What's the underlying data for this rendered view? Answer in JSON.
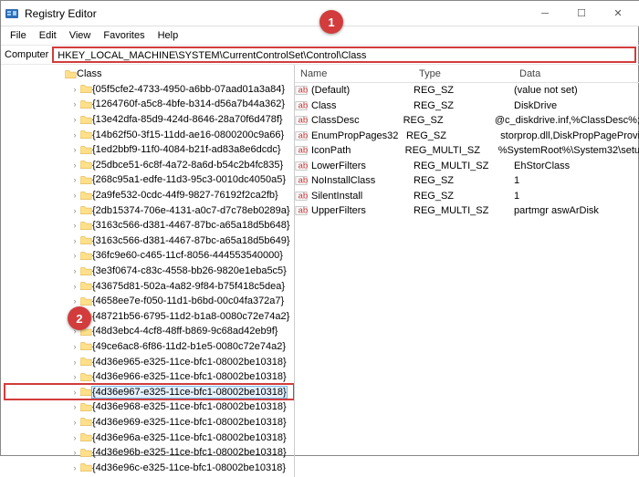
{
  "window": {
    "title": "Registry Editor"
  },
  "menu": {
    "file": "File",
    "edit": "Edit",
    "view": "View",
    "favorites": "Favorites",
    "help": "Help"
  },
  "address": {
    "label": "Computer",
    "path": "HKEY_LOCAL_MACHINE\\SYSTEM\\CurrentControlSet\\Control\\Class"
  },
  "tree": {
    "parent": "Class",
    "items": [
      "{05f5cfe2-4733-4950-a6bb-07aad01a3a84}",
      "{1264760f-a5c8-4bfe-b314-d56a7b44a362}",
      "{13e42dfa-85d9-424d-8646-28a70f6d478f}",
      "{14b62f50-3f15-11dd-ae16-0800200c9a66}",
      "{1ed2bbf9-11f0-4084-b21f-ad83a8e6dcdc}",
      "{25dbce51-6c8f-4a72-8a6d-b54c2b4fc835}",
      "{268c95a1-edfe-11d3-95c3-0010dc4050a5}",
      "{2a9fe532-0cdc-44f9-9827-76192f2ca2fb}",
      "{2db15374-706e-4131-a0c7-d7c78eb0289a}",
      "{3163c566-d381-4467-87bc-a65a18d5b648}",
      "{3163c566-d381-4467-87bc-a65a18d5b649}",
      "{36fc9e60-c465-11cf-8056-444553540000}",
      "{3e3f0674-c83c-4558-bb26-9820e1eba5c5}",
      "{43675d81-502a-4a82-9f84-b75f418c5dea}",
      "{4658ee7e-f050-11d1-b6bd-00c04fa372a7}",
      "{48721b56-6795-11d2-b1a8-0080c72e74a2}",
      "{48d3ebc4-4cf8-48ff-b869-9c68ad42eb9f}",
      "{49ce6ac8-6f86-11d2-b1e5-0080c72e74a2}",
      "{4d36e965-e325-11ce-bfc1-08002be10318}",
      "{4d36e966-e325-11ce-bfc1-08002be10318}",
      "{4d36e967-e325-11ce-bfc1-08002be10318}",
      "{4d36e968-e325-11ce-bfc1-08002be10318}",
      "{4d36e969-e325-11ce-bfc1-08002be10318}",
      "{4d36e96a-e325-11ce-bfc1-08002be10318}",
      "{4d36e96b-e325-11ce-bfc1-08002be10318}",
      "{4d36e96c-e325-11ce-bfc1-08002be10318}"
    ],
    "selected_index": 20,
    "highlight_index": 20
  },
  "columns": {
    "name": "Name",
    "type": "Type",
    "data": "Data"
  },
  "values": [
    {
      "name": "(Default)",
      "type": "REG_SZ",
      "data": "(value not set)"
    },
    {
      "name": "Class",
      "type": "REG_SZ",
      "data": "DiskDrive"
    },
    {
      "name": "ClassDesc",
      "type": "REG_SZ",
      "data": "@c_diskdrive.inf,%ClassDesc%;"
    },
    {
      "name": "EnumPropPages32",
      "type": "REG_SZ",
      "data": "storprop.dll,DiskPropPageProvi"
    },
    {
      "name": "IconPath",
      "type": "REG_MULTI_SZ",
      "data": "%SystemRoot%\\System32\\setu"
    },
    {
      "name": "LowerFilters",
      "type": "REG_MULTI_SZ",
      "data": "EhStorClass"
    },
    {
      "name": "NoInstallClass",
      "type": "REG_SZ",
      "data": "1"
    },
    {
      "name": "SilentInstall",
      "type": "REG_SZ",
      "data": "1"
    },
    {
      "name": "UpperFilters",
      "type": "REG_MULTI_SZ",
      "data": "partmgr aswArDisk"
    }
  ],
  "callouts": {
    "c1": "1",
    "c2": "2"
  }
}
